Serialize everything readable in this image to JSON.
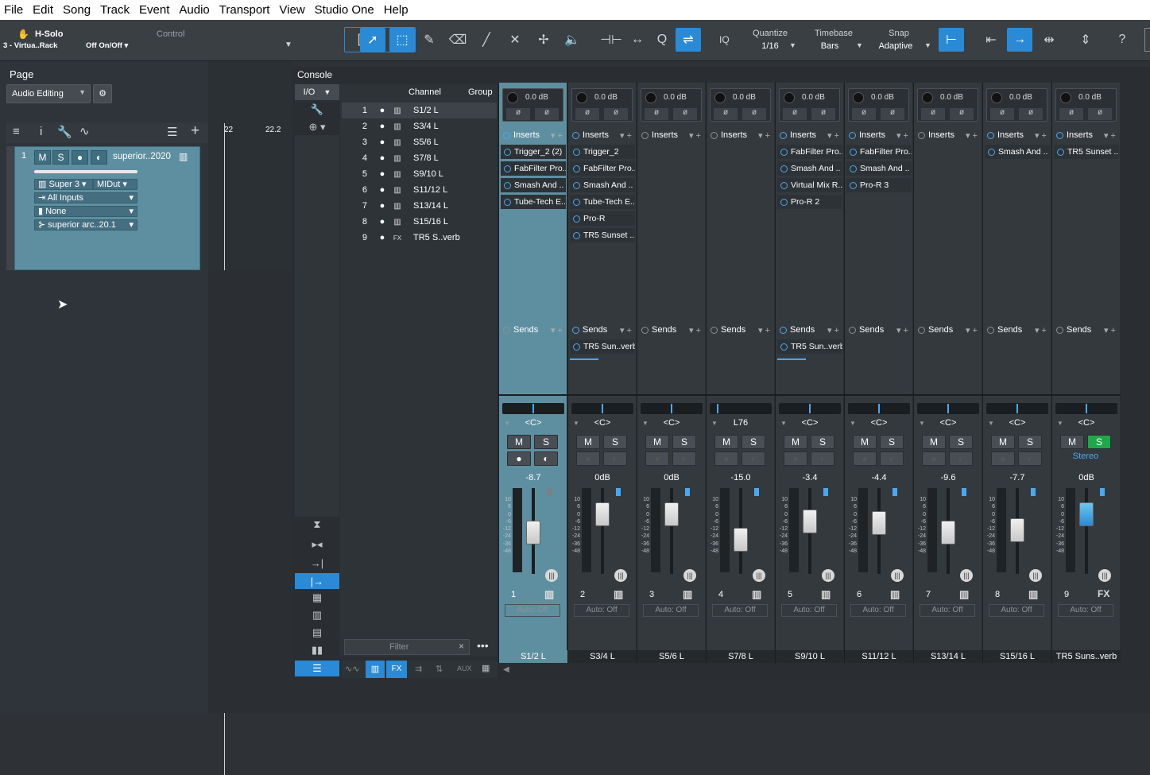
{
  "menu": [
    "File",
    "Edit",
    "Song",
    "Track",
    "Event",
    "Audio",
    "Transport",
    "View",
    "Studio One",
    "Help"
  ],
  "toolbar": {
    "solo_title": "H-Solo",
    "solo_sub": "3 - Virtua..Rack",
    "control_label": "Control",
    "control_value": "Off On/Off",
    "iq_label": "IQ",
    "quantize_label": "Quantize",
    "quantize_value": "1/16",
    "timebase_label": "Timebase",
    "timebase_value": "Bars",
    "snap_label": "Snap",
    "snap_value": "Adaptive",
    "help_label": "?"
  },
  "left": {
    "page_label": "Page",
    "page_value": "Audio Editing",
    "track": {
      "number": "1",
      "m": "M",
      "s": "S",
      "name": "superior..2020",
      "instrument": "Super 3",
      "midi": "MIDut",
      "input": "All Inputs",
      "output": "None",
      "preset": "superior arc..20.1"
    },
    "ruler": [
      "22",
      "22.2"
    ]
  },
  "console": {
    "title": "Console",
    "io_label": "I/O",
    "header_channel": "Channel",
    "header_group": "Group",
    "filter_placeholder": "Filter",
    "bottom_tabs": [
      "FX",
      "AUX"
    ],
    "channel_list": [
      {
        "n": "1",
        "type": "instr",
        "name": "S1/2 L"
      },
      {
        "n": "2",
        "type": "instr",
        "name": "S3/4 L"
      },
      {
        "n": "3",
        "type": "instr",
        "name": "S5/6 L"
      },
      {
        "n": "4",
        "type": "instr",
        "name": "S7/8 L"
      },
      {
        "n": "5",
        "type": "instr",
        "name": "S9/10 L"
      },
      {
        "n": "6",
        "type": "instr",
        "name": "S11/12 L"
      },
      {
        "n": "7",
        "type": "instr",
        "name": "S13/14 L"
      },
      {
        "n": "8",
        "type": "instr",
        "name": "S15/16 L"
      },
      {
        "n": "9",
        "type": "fx",
        "name": "TR5 S..verb"
      }
    ],
    "strips": [
      {
        "num": "1",
        "name": "S1/2 L",
        "gain": "0.0 dB",
        "inserts": [
          "Trigger_2 (2)",
          "FabFilter Pro..",
          "Smash And ..",
          "Tube-Tech E.."
        ],
        "sends": [],
        "pan": "<C>",
        "pan_val": 0,
        "vol": "-8.7",
        "fader_level": 0.55,
        "auto": "Auto: Off",
        "sel": true,
        "footer": "instr",
        "solo_on": false
      },
      {
        "num": "2",
        "name": "S3/4 L",
        "gain": "0.0 dB",
        "inserts": [
          "Trigger_2",
          "FabFilter Pro..",
          "Smash And ..",
          "Tube-Tech E..",
          "Pro-R",
          "TR5 Sunset .."
        ],
        "sends": [
          "TR5 Sun..verb"
        ],
        "pan": "<C>",
        "pan_val": 0,
        "vol": "0dB",
        "fader_level": 0.8,
        "auto": "Auto: Off",
        "sel": false,
        "footer": "instr",
        "solo_on": false
      },
      {
        "num": "3",
        "name": "S5/6 L",
        "gain": "0.0 dB",
        "inserts": [],
        "sends": [],
        "pan": "<C>",
        "pan_val": 0,
        "vol": "0dB",
        "fader_level": 0.8,
        "auto": "Auto: Off",
        "sel": false,
        "footer": "instr",
        "solo_on": false
      },
      {
        "num": "4",
        "name": "S7/8 L",
        "gain": "0.0 dB",
        "inserts": [],
        "sends": [],
        "pan": "L76",
        "pan_val": -0.76,
        "vol": "-15.0",
        "fader_level": 0.45,
        "auto": "Auto: Off",
        "sel": false,
        "footer": "instr",
        "solo_on": false
      },
      {
        "num": "5",
        "name": "S9/10 L",
        "gain": "0.0 dB",
        "inserts": [
          "FabFilter Pro..",
          "Smash And ..",
          "Virtual Mix R..",
          "Pro-R 2"
        ],
        "sends": [
          "TR5 Sun..verb"
        ],
        "pan": "<C>",
        "pan_val": 0,
        "vol": "-3.4",
        "fader_level": 0.7,
        "auto": "Auto: Off",
        "sel": false,
        "footer": "instr",
        "solo_on": false
      },
      {
        "num": "6",
        "name": "S11/12 L",
        "gain": "0.0 dB",
        "inserts": [
          "FabFilter Pro..",
          "Smash And ..",
          "Pro-R 3"
        ],
        "sends": [],
        "pan": "<C>",
        "pan_val": 0,
        "vol": "-4.4",
        "fader_level": 0.68,
        "auto": "Auto: Off",
        "sel": false,
        "footer": "instr",
        "solo_on": false
      },
      {
        "num": "7",
        "name": "S13/14 L",
        "gain": "0.0 dB",
        "inserts": [],
        "sends": [],
        "pan": "<C>",
        "pan_val": 0,
        "vol": "-9.6",
        "fader_level": 0.55,
        "auto": "Auto: Off",
        "sel": false,
        "footer": "instr",
        "solo_on": false
      },
      {
        "num": "8",
        "name": "S15/16 L",
        "gain": "0.0 dB",
        "inserts": [
          "Smash And .."
        ],
        "sends": [],
        "pan": "<C>",
        "pan_val": 0,
        "vol": "-7.7",
        "fader_level": 0.58,
        "auto": "Auto: Off",
        "sel": false,
        "footer": "instr",
        "solo_on": false
      },
      {
        "num": "9",
        "name": "TR5 Suns..verb",
        "gain": "0.0 dB",
        "inserts": [
          "TR5 Sunset .."
        ],
        "sends": [],
        "pan": "<C>",
        "pan_val": 0,
        "vol": "0dB",
        "fader_level": 0.8,
        "auto": "Auto: Off",
        "sel": false,
        "footer": "FX",
        "solo_on": true,
        "stereo": "Stereo"
      }
    ],
    "labels": {
      "inserts": "Inserts",
      "sends": "Sends",
      "m": "M",
      "s": "S"
    },
    "meter_scale": [
      "10",
      "6",
      "0",
      "-6",
      "-12",
      "-24",
      "-36",
      "-48"
    ]
  },
  "colors": {
    "accent": "#2a8ad6",
    "selected": "#5e8fa0",
    "solo": "#1fa84a"
  }
}
